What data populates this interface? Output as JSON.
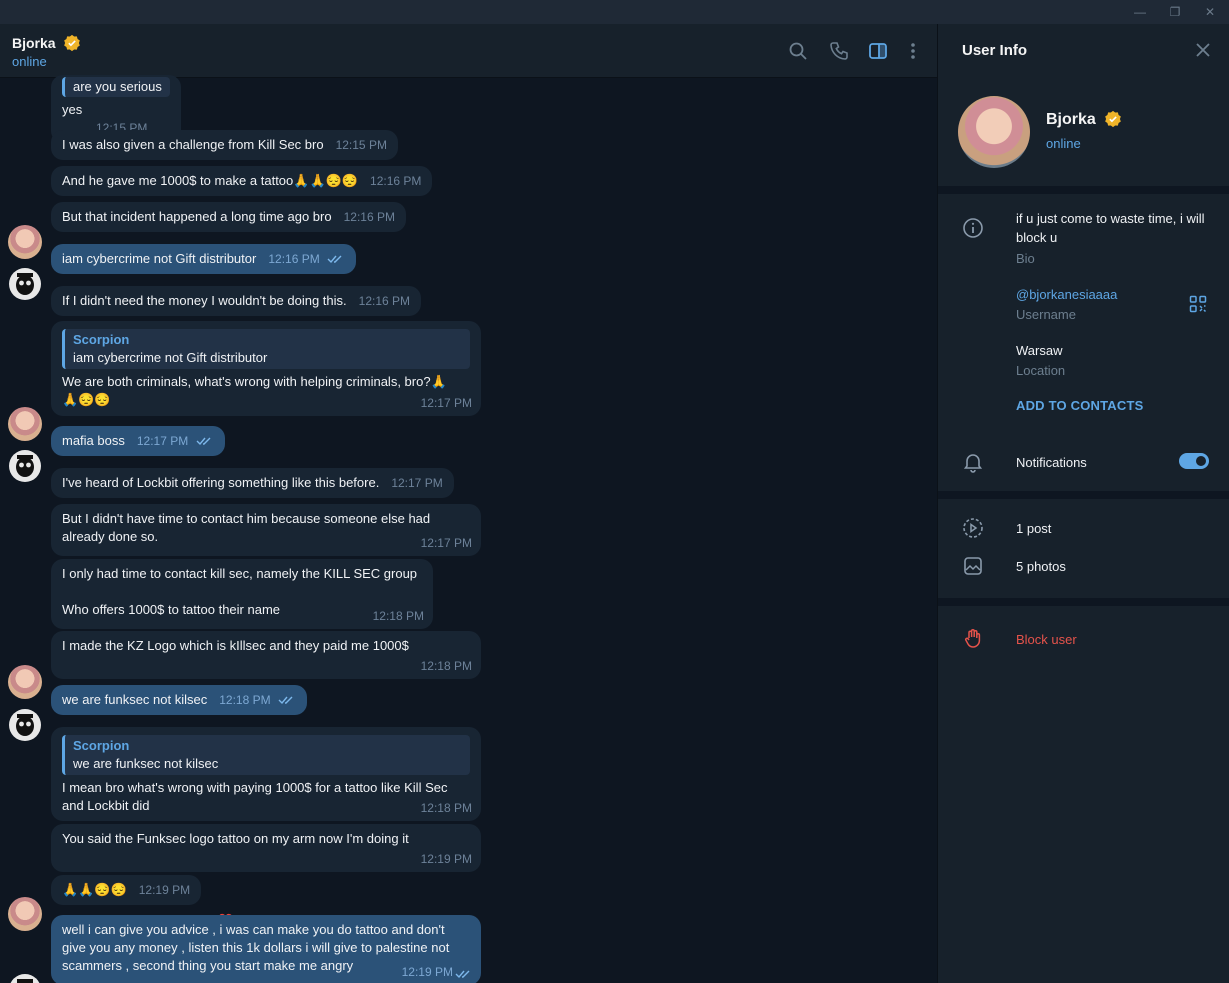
{
  "window": {
    "minimize": "—",
    "restore": "❐",
    "close": "✕"
  },
  "header": {
    "name": "Bjorka",
    "status": "online"
  },
  "messages": [
    {
      "reply_text": "are you serious",
      "text": "yes",
      "time": "12:15 PM"
    },
    {
      "text": "I was also given a challenge from Kill Sec bro",
      "time": "12:15 PM"
    },
    {
      "text": "And he gave me 1000$ to make a tattoo🙏🙏😔😔",
      "time": "12:16 PM"
    },
    {
      "text": "But that incident happened a long time ago bro",
      "time": "12:16 PM"
    },
    {
      "text": "iam cybercrime not Gift distributor",
      "time": "12:16 PM"
    },
    {
      "text": "If I didn't need the money I wouldn't be doing this.",
      "time": "12:16 PM"
    },
    {
      "reply_name": "Scorpion",
      "reply_text": "iam cybercrime not Gift distributor",
      "text": "We are both criminals, what's wrong with helping criminals, bro?🙏🙏😔😔",
      "time": "12:17 PM"
    },
    {
      "text": "mafia boss",
      "time": "12:17 PM"
    },
    {
      "text": "I've heard of Lockbit offering something like this before.",
      "time": "12:17 PM"
    },
    {
      "text": "But I didn't have time to contact him because someone else had already done so.",
      "time": "12:17 PM"
    },
    {
      "text": "I only had time to contact kill sec, namely the KILL SEC group",
      "text2": "Who offers 1000$ to tattoo their name",
      "time": "12:18 PM"
    },
    {
      "text": "I made the KZ Logo which is kIllsec and they paid me 1000$",
      "time": "12:18 PM"
    },
    {
      "text": "we are funksec not kilsec",
      "time": "12:18 PM"
    },
    {
      "reply_name": "Scorpion",
      "reply_text": "we are funksec not kilsec",
      "text": "I mean bro what's wrong with paying 1000$ for a tattoo like Kill Sec and Lockbit did",
      "time": "12:18 PM"
    },
    {
      "text": "You said the Funksec logo tattoo on my arm now I'm doing it",
      "time": "12:19 PM"
    },
    {
      "text": "🙏🙏😔😔",
      "time": "12:19 PM",
      "reaction": "❤️"
    },
    {
      "text": "well i can give you advice , i was can make you do tattoo and don't give you any money , listen this 1k dollars i will give to palestine not scammers , second thing you start make me angry",
      "time": "12:19 PM"
    }
  ],
  "info": {
    "title": "User Info",
    "name": "Bjorka",
    "status": "online",
    "bio": "if u just come to waste time, i will block u",
    "bio_label": "Bio",
    "username": "@bjorkanesiaaaa",
    "username_label": "Username",
    "location": "Warsaw",
    "location_label": "Location",
    "add_contacts": "ADD TO CONTACTS",
    "notifications": "Notifications",
    "notifications_on": true,
    "posts": "1 post",
    "photos": "5 photos",
    "block": "Block user"
  },
  "colors": {
    "accent": "#5ea6e4",
    "outgoing": "#2b5278",
    "incoming": "#182533",
    "danger": "#e5534b"
  }
}
